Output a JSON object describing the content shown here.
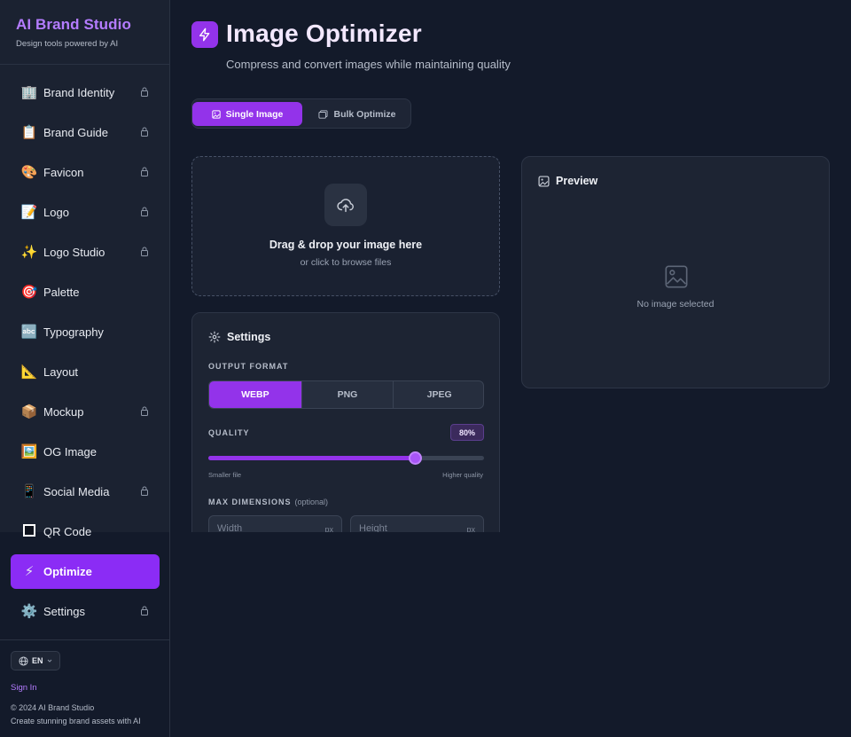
{
  "app": {
    "brand_title": "AI Brand Studio",
    "brand_subtitle": "Design tools powered by AI"
  },
  "sidebar": {
    "items": [
      {
        "emoji": "🏢",
        "label": "Brand Identity",
        "locked": true
      },
      {
        "emoji": "📋",
        "label": "Brand Guide",
        "locked": true
      },
      {
        "emoji": "🎨",
        "label": "Favicon",
        "locked": true
      },
      {
        "emoji": "📝",
        "label": "Logo",
        "locked": true
      },
      {
        "emoji": "✨",
        "label": "Logo Studio",
        "locked": true
      },
      {
        "emoji": "🎯",
        "label": "Palette",
        "locked": false
      },
      {
        "emoji": "🔤",
        "label": "Typography",
        "locked": false
      },
      {
        "emoji": "📐",
        "label": "Layout",
        "locked": false
      },
      {
        "emoji": "📦",
        "label": "Mockup",
        "locked": true
      },
      {
        "emoji": "🖼️",
        "label": "OG Image",
        "locked": false
      },
      {
        "emoji": "📱",
        "label": "Social Media",
        "locked": true
      },
      {
        "emoji": "qr-code-icon",
        "label": "QR Code",
        "locked": false
      },
      {
        "emoji": "⚡",
        "label": "Optimize",
        "locked": false,
        "active": true
      },
      {
        "emoji": "⚙️",
        "label": "Settings",
        "locked": true
      }
    ],
    "language": "EN",
    "sign_in": "Sign In",
    "copyright": "© 2024 AI Brand Studio",
    "tagline": "Create stunning brand assets with AI"
  },
  "header": {
    "title": "Image Optimizer",
    "subtitle": "Compress and convert images while maintaining quality",
    "icon": "lightning-icon"
  },
  "tabs": {
    "single": "Single Image",
    "bulk": "Bulk Optimize",
    "active": "single"
  },
  "dropzone": {
    "title": "Drag & drop your image here",
    "subtitle": "or click to browse files"
  },
  "settings": {
    "title": "Settings",
    "output_format_label": "OUTPUT FORMAT",
    "formats": [
      "WEBP",
      "PNG",
      "JPEG"
    ],
    "selected_format": "WEBP",
    "quality_label": "QUALITY",
    "quality_value": 80,
    "quality_display": "80%",
    "slider_min_label": "Smaller file",
    "slider_max_label": "Higher quality",
    "max_dimensions_label": "MAX DIMENSIONS",
    "optional_label": "(optional)",
    "width_placeholder": "Width",
    "height_placeholder": "Height",
    "unit": "px"
  },
  "preview": {
    "title": "Preview",
    "empty_text": "No image selected"
  },
  "colors": {
    "accent": "#9333ea",
    "brand_text": "#b47cff",
    "background": "#131a2a",
    "panel": "#1d2433"
  }
}
